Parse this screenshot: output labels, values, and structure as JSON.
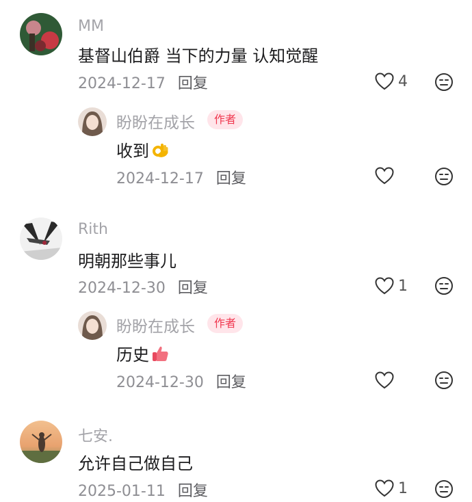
{
  "comments": [
    {
      "username": "MM",
      "text": "基督山伯爵 当下的力量 认知觉醒",
      "date": "2024-12-17",
      "reply_label": "回复",
      "likes": "4",
      "author_reply": {
        "username": "盼盼在成长",
        "badge": "作者",
        "text": "收到",
        "emoji": "ok-hand",
        "date": "2024-12-17",
        "reply_label": "回复"
      }
    },
    {
      "username": "Rith",
      "text": "明朝那些事儿",
      "date": "2024-12-30",
      "reply_label": "回复",
      "likes": "1",
      "author_reply": {
        "username": "盼盼在成长",
        "badge": "作者",
        "text": "历史",
        "emoji": "thumbs-up",
        "date": "2024-12-30",
        "reply_label": "回复"
      }
    },
    {
      "username": "七安.",
      "text": "允许自己做自己",
      "date": "2025-01-11",
      "reply_label": "回复",
      "likes": "1"
    }
  ]
}
